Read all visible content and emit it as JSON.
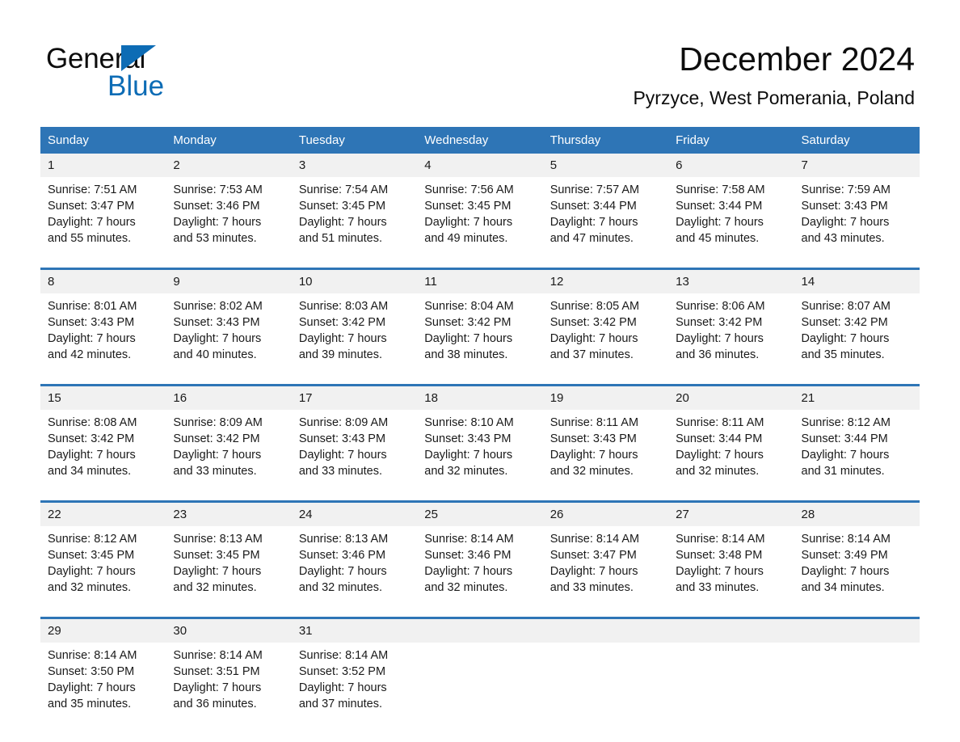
{
  "brand": {
    "name_part1": "General",
    "name_part2": "Blue",
    "logo_icon": "triangle-flag-icon",
    "accent_color": "#0d6cb5"
  },
  "header": {
    "title": "December 2024",
    "location": "Pyrzyce, West Pomerania, Poland"
  },
  "theme": {
    "header_blue": "#2e75b6",
    "daynum_stripe": "#f1f1f1",
    "text": "#1a1a1a"
  },
  "calendar": {
    "weekday_headers": [
      "Sunday",
      "Monday",
      "Tuesday",
      "Wednesday",
      "Thursday",
      "Friday",
      "Saturday"
    ],
    "weeks": [
      {
        "days": [
          {
            "num": "1",
            "l1": "Sunrise: 7:51 AM",
            "l2": "Sunset: 3:47 PM",
            "l3": "Daylight: 7 hours",
            "l4": "and 55 minutes."
          },
          {
            "num": "2",
            "l1": "Sunrise: 7:53 AM",
            "l2": "Sunset: 3:46 PM",
            "l3": "Daylight: 7 hours",
            "l4": "and 53 minutes."
          },
          {
            "num": "3",
            "l1": "Sunrise: 7:54 AM",
            "l2": "Sunset: 3:45 PM",
            "l3": "Daylight: 7 hours",
            "l4": "and 51 minutes."
          },
          {
            "num": "4",
            "l1": "Sunrise: 7:56 AM",
            "l2": "Sunset: 3:45 PM",
            "l3": "Daylight: 7 hours",
            "l4": "and 49 minutes."
          },
          {
            "num": "5",
            "l1": "Sunrise: 7:57 AM",
            "l2": "Sunset: 3:44 PM",
            "l3": "Daylight: 7 hours",
            "l4": "and 47 minutes."
          },
          {
            "num": "6",
            "l1": "Sunrise: 7:58 AM",
            "l2": "Sunset: 3:44 PM",
            "l3": "Daylight: 7 hours",
            "l4": "and 45 minutes."
          },
          {
            "num": "7",
            "l1": "Sunrise: 7:59 AM",
            "l2": "Sunset: 3:43 PM",
            "l3": "Daylight: 7 hours",
            "l4": "and 43 minutes."
          }
        ]
      },
      {
        "days": [
          {
            "num": "8",
            "l1": "Sunrise: 8:01 AM",
            "l2": "Sunset: 3:43 PM",
            "l3": "Daylight: 7 hours",
            "l4": "and 42 minutes."
          },
          {
            "num": "9",
            "l1": "Sunrise: 8:02 AM",
            "l2": "Sunset: 3:43 PM",
            "l3": "Daylight: 7 hours",
            "l4": "and 40 minutes."
          },
          {
            "num": "10",
            "l1": "Sunrise: 8:03 AM",
            "l2": "Sunset: 3:42 PM",
            "l3": "Daylight: 7 hours",
            "l4": "and 39 minutes."
          },
          {
            "num": "11",
            "l1": "Sunrise: 8:04 AM",
            "l2": "Sunset: 3:42 PM",
            "l3": "Daylight: 7 hours",
            "l4": "and 38 minutes."
          },
          {
            "num": "12",
            "l1": "Sunrise: 8:05 AM",
            "l2": "Sunset: 3:42 PM",
            "l3": "Daylight: 7 hours",
            "l4": "and 37 minutes."
          },
          {
            "num": "13",
            "l1": "Sunrise: 8:06 AM",
            "l2": "Sunset: 3:42 PM",
            "l3": "Daylight: 7 hours",
            "l4": "and 36 minutes."
          },
          {
            "num": "14",
            "l1": "Sunrise: 8:07 AM",
            "l2": "Sunset: 3:42 PM",
            "l3": "Daylight: 7 hours",
            "l4": "and 35 minutes."
          }
        ]
      },
      {
        "days": [
          {
            "num": "15",
            "l1": "Sunrise: 8:08 AM",
            "l2": "Sunset: 3:42 PM",
            "l3": "Daylight: 7 hours",
            "l4": "and 34 minutes."
          },
          {
            "num": "16",
            "l1": "Sunrise: 8:09 AM",
            "l2": "Sunset: 3:42 PM",
            "l3": "Daylight: 7 hours",
            "l4": "and 33 minutes."
          },
          {
            "num": "17",
            "l1": "Sunrise: 8:09 AM",
            "l2": "Sunset: 3:43 PM",
            "l3": "Daylight: 7 hours",
            "l4": "and 33 minutes."
          },
          {
            "num": "18",
            "l1": "Sunrise: 8:10 AM",
            "l2": "Sunset: 3:43 PM",
            "l3": "Daylight: 7 hours",
            "l4": "and 32 minutes."
          },
          {
            "num": "19",
            "l1": "Sunrise: 8:11 AM",
            "l2": "Sunset: 3:43 PM",
            "l3": "Daylight: 7 hours",
            "l4": "and 32 minutes."
          },
          {
            "num": "20",
            "l1": "Sunrise: 8:11 AM",
            "l2": "Sunset: 3:44 PM",
            "l3": "Daylight: 7 hours",
            "l4": "and 32 minutes."
          },
          {
            "num": "21",
            "l1": "Sunrise: 8:12 AM",
            "l2": "Sunset: 3:44 PM",
            "l3": "Daylight: 7 hours",
            "l4": "and 31 minutes."
          }
        ]
      },
      {
        "days": [
          {
            "num": "22",
            "l1": "Sunrise: 8:12 AM",
            "l2": "Sunset: 3:45 PM",
            "l3": "Daylight: 7 hours",
            "l4": "and 32 minutes."
          },
          {
            "num": "23",
            "l1": "Sunrise: 8:13 AM",
            "l2": "Sunset: 3:45 PM",
            "l3": "Daylight: 7 hours",
            "l4": "and 32 minutes."
          },
          {
            "num": "24",
            "l1": "Sunrise: 8:13 AM",
            "l2": "Sunset: 3:46 PM",
            "l3": "Daylight: 7 hours",
            "l4": "and 32 minutes."
          },
          {
            "num": "25",
            "l1": "Sunrise: 8:14 AM",
            "l2": "Sunset: 3:46 PM",
            "l3": "Daylight: 7 hours",
            "l4": "and 32 minutes."
          },
          {
            "num": "26",
            "l1": "Sunrise: 8:14 AM",
            "l2": "Sunset: 3:47 PM",
            "l3": "Daylight: 7 hours",
            "l4": "and 33 minutes."
          },
          {
            "num": "27",
            "l1": "Sunrise: 8:14 AM",
            "l2": "Sunset: 3:48 PM",
            "l3": "Daylight: 7 hours",
            "l4": "and 33 minutes."
          },
          {
            "num": "28",
            "l1": "Sunrise: 8:14 AM",
            "l2": "Sunset: 3:49 PM",
            "l3": "Daylight: 7 hours",
            "l4": "and 34 minutes."
          }
        ]
      },
      {
        "days": [
          {
            "num": "29",
            "l1": "Sunrise: 8:14 AM",
            "l2": "Sunset: 3:50 PM",
            "l3": "Daylight: 7 hours",
            "l4": "and 35 minutes."
          },
          {
            "num": "30",
            "l1": "Sunrise: 8:14 AM",
            "l2": "Sunset: 3:51 PM",
            "l3": "Daylight: 7 hours",
            "l4": "and 36 minutes."
          },
          {
            "num": "31",
            "l1": "Sunrise: 8:14 AM",
            "l2": "Sunset: 3:52 PM",
            "l3": "Daylight: 7 hours",
            "l4": "and 37 minutes."
          },
          {
            "num": "",
            "l1": "",
            "l2": "",
            "l3": "",
            "l4": ""
          },
          {
            "num": "",
            "l1": "",
            "l2": "",
            "l3": "",
            "l4": ""
          },
          {
            "num": "",
            "l1": "",
            "l2": "",
            "l3": "",
            "l4": ""
          },
          {
            "num": "",
            "l1": "",
            "l2": "",
            "l3": "",
            "l4": ""
          }
        ]
      }
    ]
  }
}
